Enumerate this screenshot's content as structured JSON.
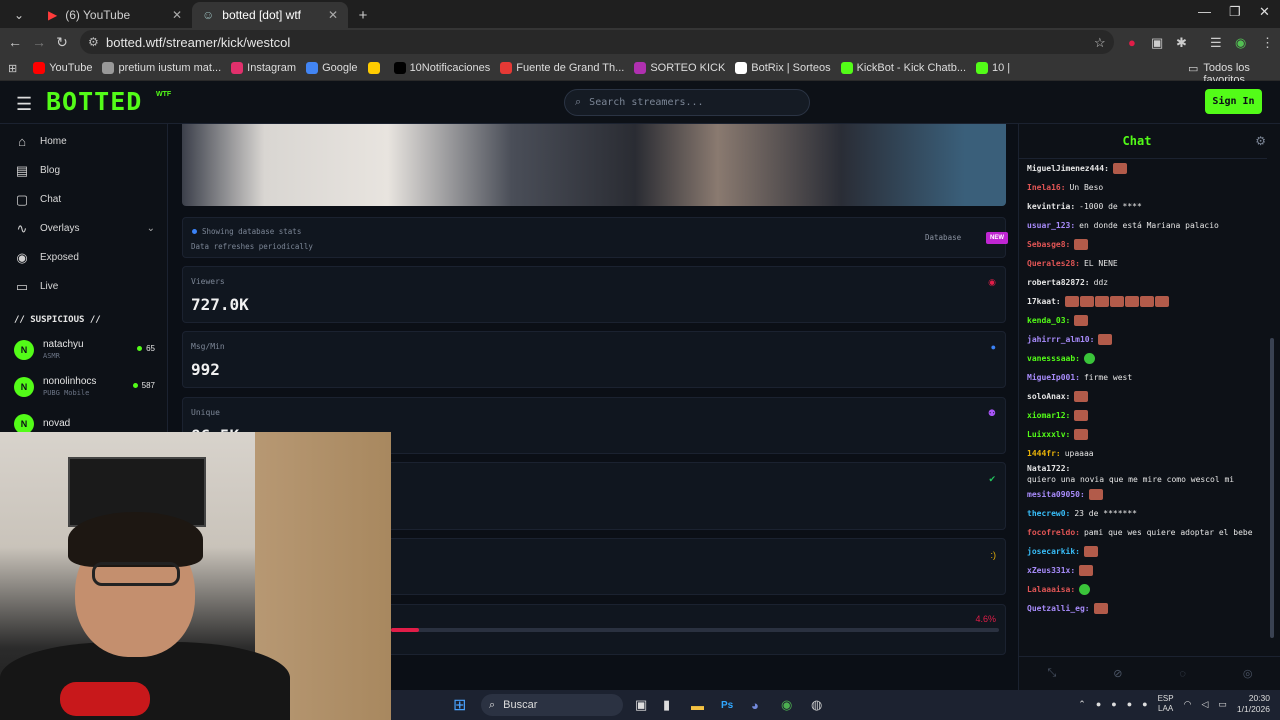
{
  "browser": {
    "tabs": [
      {
        "title": "(6) YouTube",
        "active": false
      },
      {
        "title": "botted [dot] wtf",
        "active": true
      }
    ],
    "url": "botted.wtf/streamer/kick/westcol",
    "bookmarks": [
      {
        "label": "YouTube",
        "color": "#ff0000"
      },
      {
        "label": "pretium iustum mat...",
        "color": "#999999"
      },
      {
        "label": "Instagram",
        "color": "#e1306c"
      },
      {
        "label": "Google",
        "color": "#4285f4"
      },
      {
        "label": "",
        "color": "#ffcc00"
      },
      {
        "label": "10Notificaciones",
        "color": "#000000"
      },
      {
        "label": "Fuente de Grand Th...",
        "color": "#e53935"
      },
      {
        "label": "SORTEO KICK",
        "color": "#b030b0"
      },
      {
        "label": "BotRix | Sorteos",
        "color": "#ffffff"
      },
      {
        "label": "KickBot - Kick Chatb...",
        "color": "#53fc18"
      },
      {
        "label": "10 |",
        "color": "#53fc18"
      }
    ],
    "all_bookmarks": "Todos los favoritos"
  },
  "site": {
    "logo": "BOTTED",
    "logo_sub": "WTF",
    "search_placeholder": "Search streamers...",
    "signin": "Sign In",
    "accent": "#53fc18"
  },
  "sidebar": {
    "items": [
      {
        "label": "Home",
        "icon": "home-icon"
      },
      {
        "label": "Blog",
        "icon": "document-icon"
      },
      {
        "label": "Chat",
        "icon": "chat-icon"
      },
      {
        "label": "Overlays",
        "icon": "activity-icon"
      },
      {
        "label": "Exposed",
        "icon": "eye-icon"
      },
      {
        "label": "Live",
        "icon": "tv-icon"
      }
    ],
    "suspicious_header": "// SUSPICIOUS //",
    "suspicious": [
      {
        "initial": "N",
        "name": "natachyu",
        "category": "ASMR",
        "count": "65"
      },
      {
        "initial": "N",
        "name": "nonolinhocs",
        "category": "PUBG Mobile",
        "count": "587"
      },
      {
        "initial": "N",
        "name": "novad",
        "category": "",
        "count": ""
      }
    ]
  },
  "main": {
    "info": {
      "line1": "Showing database stats",
      "line2": "Data refreshes periodically",
      "source": "Database",
      "badge": "NEW"
    },
    "stats": [
      {
        "label": "Viewers",
        "value": "727.0K",
        "icon_color": "#e11d48"
      },
      {
        "label": "Msg/Min",
        "value": "992",
        "icon_color": "#3b82f6"
      },
      {
        "label": "Unique",
        "value": "86.5K",
        "icon_color": "#a855f7"
      },
      {
        "label": "",
        "value": "",
        "icon_color": "#22c55e"
      },
      {
        "label": "",
        "value": "",
        "icon": ":)",
        "icon_color": "#eab308"
      }
    ],
    "ratio": {
      "label": "4.6%",
      "value": 0.046
    }
  },
  "chat": {
    "title": "Chat",
    "messages": [
      {
        "user": "MiguelJimenez444:",
        "color": "#e6e6e6",
        "text": "",
        "emotes": 1
      },
      {
        "user": "Inela16:",
        "color": "#e05555",
        "text": "Un Beso",
        "emotes": 0
      },
      {
        "user": "kevintria:",
        "color": "#e6e6e6",
        "text": "-1000 de ****",
        "emotes": 0
      },
      {
        "user": "usuar_123:",
        "color": "#a78bfa",
        "text": "en donde está Mariana palacio",
        "emotes": 0
      },
      {
        "user": "Sebasge8:",
        "color": "#e05555",
        "text": "",
        "emotes": 1
      },
      {
        "user": "Querales28:",
        "color": "#e05555",
        "text": "EL NENE",
        "emotes": 0
      },
      {
        "user": "roberta82872:",
        "color": "#e6e6e6",
        "text": "ddz",
        "emotes": 0
      },
      {
        "user": "17kaat:",
        "color": "#e6e6e6",
        "text": "",
        "emotes": 7
      },
      {
        "user": "kenda_03:",
        "color": "#53fc18",
        "text": "",
        "emotes": 1
      },
      {
        "user": "jahirrr_alm10:",
        "color": "#a78bfa",
        "text": "",
        "emotes": 1
      },
      {
        "user": "vanesssaab:",
        "color": "#53fc18",
        "text": "",
        "emotes": 1,
        "green": true
      },
      {
        "user": "MigueIp001:",
        "color": "#a78bfa",
        "text": "firme west",
        "emotes": 0
      },
      {
        "user": "soloAnax:",
        "color": "#e6e6e6",
        "text": "",
        "emotes": 1
      },
      {
        "user": "xiomar12:",
        "color": "#53fc18",
        "text": "",
        "emotes": 1
      },
      {
        "user": "Luixxxlv:",
        "color": "#53fc18",
        "text": "",
        "emotes": 1
      },
      {
        "user": "1444fr:",
        "color": "#eab308",
        "text": "upaaaa",
        "emotes": 0
      },
      {
        "user": "Nata1722:",
        "color": "#e6e6e6",
        "text": "quiero una novia que me mire como wescol mi",
        "emotes": 0
      },
      {
        "user": "mesita09050:",
        "color": "#a78bfa",
        "text": "",
        "emotes": 1
      },
      {
        "user": "thecrew0:",
        "color": "#38bdf8",
        "text": "23 de *******",
        "emotes": 0
      },
      {
        "user": "focofreldo:",
        "color": "#e05555",
        "text": "pami que wes quiere adoptar el bebe",
        "emotes": 0
      },
      {
        "user": "josecarkik:",
        "color": "#38bdf8",
        "text": "",
        "emotes": 1
      },
      {
        "user": "xZeus331x:",
        "color": "#a78bfa",
        "text": "",
        "emotes": 1
      },
      {
        "user": "Lalaaaisa:",
        "color": "#e05555",
        "text": "",
        "emotes": 1,
        "green": true
      },
      {
        "user": "Quetzalli_eg:",
        "color": "#a78bfa",
        "text": "",
        "emotes": 1
      }
    ]
  },
  "taskbar": {
    "search": "Buscar",
    "lang": "ESP",
    "lang2": "LAA",
    "time": "20:30",
    "date": "1/1/2026"
  }
}
